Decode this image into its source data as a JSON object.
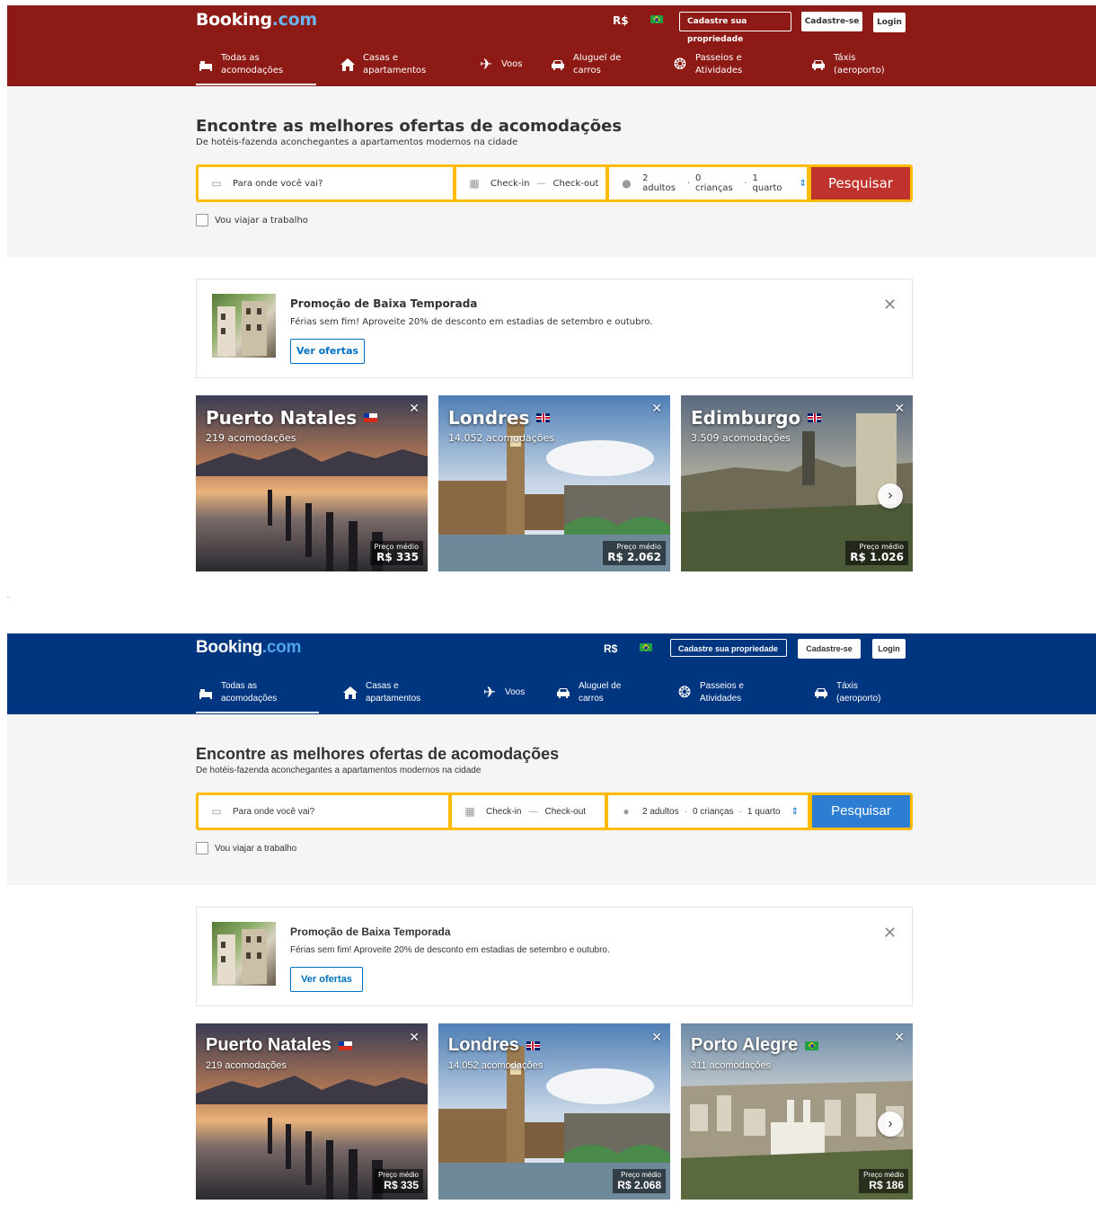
{
  "header": {
    "logo_main": "Booking",
    "logo_suffix": ".com",
    "currency": "R$",
    "list_property": "Cadastre sua propriedade",
    "signup": "Cadastre-se",
    "login": "Login",
    "brand_color_variant_a": "#8e1a16",
    "brand_color_variant_b": "#003580"
  },
  "nav": [
    {
      "label": "Todas as\nacomodações",
      "icon": "bed-icon"
    },
    {
      "label": "Casas e\napartamentos",
      "icon": "house-icon"
    },
    {
      "label": "Voos",
      "icon": "plane-icon"
    },
    {
      "label": "Aluguel de\ncarros",
      "icon": "car-icon"
    },
    {
      "label": "Passeios e\nAtividades",
      "icon": "attractions-icon"
    },
    {
      "label": "Táxis\n(aeroporto)",
      "icon": "taxi-icon"
    }
  ],
  "hero": {
    "title": "Encontre as melhores ofertas de acomodações",
    "subtitle": "De hotéis-fazenda aconchegantes a apartamentos modernos na cidade"
  },
  "search": {
    "destination_placeholder": "Para onde você vai?",
    "checkin": "Check-in",
    "dash": "—",
    "checkout": "Check-out",
    "adults": "2 adultos",
    "children": "0 crianças",
    "rooms": "1 quarto",
    "dot": "·",
    "button": "Pesquisar",
    "work_trip": "Vou viajar a trabalho"
  },
  "promo": {
    "title": "Promoção de Baixa Temporada",
    "text": "Férias sem fim! Aproveite 20% de desconto em estadias de setembro e outubro.",
    "button": "Ver ofertas"
  },
  "price_label": "Preço médio",
  "cards_a": [
    {
      "city": "Puerto Natales",
      "count": "219 acomodações",
      "price": "R$ 335",
      "flag": "chile-flag"
    },
    {
      "city": "Londres",
      "count": "14.052 acomodações",
      "price": "R$ 2.062",
      "flag": "uk-flag"
    },
    {
      "city": "Edimburgo",
      "count": "3.509 acomodações",
      "price": "R$ 1.026",
      "flag": "uk-flag"
    }
  ],
  "cards_b": [
    {
      "city": "Puerto Natales",
      "count": "219 acomodações",
      "price": "R$ 335",
      "flag": "chile-flag"
    },
    {
      "city": "Londres",
      "count": "14.052 acomodações",
      "price": "R$ 2.068",
      "flag": "uk-flag"
    },
    {
      "city": "Porto Alegre",
      "count": "311 acomodações",
      "price": "R$ 186",
      "flag": "brazil-flag"
    }
  ]
}
